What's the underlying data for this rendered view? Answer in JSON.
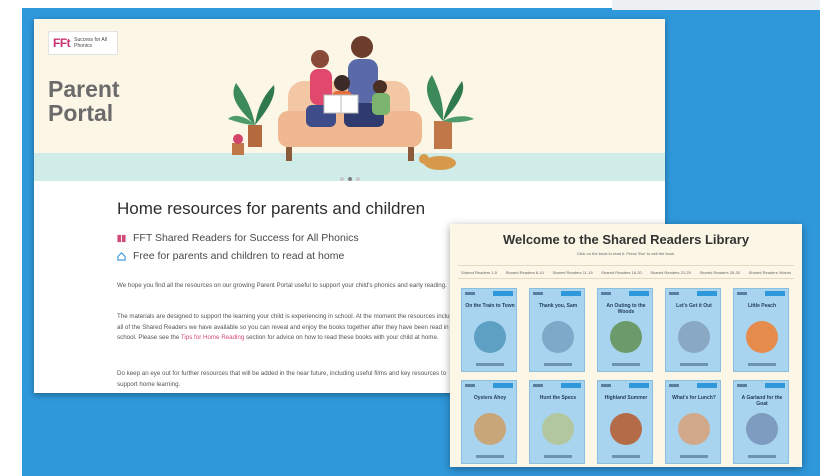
{
  "portal": {
    "logo_mark": "FFt",
    "logo_text": "Success for All Phonics",
    "title_line1": "Parent",
    "title_line2": "Portal",
    "heading": "Home resources for parents and children",
    "bullets": [
      "FFT Shared Readers for Success for All Phonics",
      "Free for parents and children to read at home"
    ],
    "paragraph1": "We hope you find all the resources on our growing Parent Portal useful to support your child's phonics and early reading.",
    "paragraph2_a": "The materials are designed to support the learning your child is experiencing in school. At the moment the resources include all of the Shared Readers we have available so you can reveal and enjoy the books together after they have been read in school. Please see the ",
    "paragraph2_link": "Tips for Home Reading",
    "paragraph2_b": " section for advice on how to read these books with your child at home.",
    "paragraph3": "Do keep an eye out for further resources that will be added in the near future, including useful films and key resources to support home learning."
  },
  "library": {
    "title": "Welcome to the Shared Readers Library",
    "subtitle": "Click on the book to read it. Press 'Esc' to exit the book.",
    "tabs": [
      "Shared Readers 1-5",
      "Shared Readers 6-10",
      "Shared Readers 11-15",
      "Shared Readers 16-20",
      "Shared Readers 21-25",
      "Shared Readers 26-30",
      "Shared Readers Videos"
    ],
    "books": [
      {
        "title": "On the Train to Town",
        "art": "#5e9fc4"
      },
      {
        "title": "Thank you, Sam",
        "art": "#7fa9c8"
      },
      {
        "title": "An Outing to the Woods",
        "art": "#6d9a6a"
      },
      {
        "title": "Let's Get it Out",
        "art": "#89a8c4"
      },
      {
        "title": "Little Peach",
        "art": "#e58b4c"
      },
      {
        "title": "Oysters Ahoy",
        "art": "#c9a57a"
      },
      {
        "title": "Hunt the Specs",
        "art": "#b2c7a0"
      },
      {
        "title": "Highland Summer",
        "art": "#b46b47"
      },
      {
        "title": "What's for Lunch?",
        "art": "#d1a88a"
      },
      {
        "title": "A Garland for the Goat",
        "art": "#7e9cbf"
      }
    ]
  },
  "colors": {
    "background_blue": "#2f98db",
    "hero_cream": "#fbf6e6",
    "hero_mint": "#cfece8",
    "accent_pink": "#d14a7a",
    "book_blue": "#a9d4ef"
  }
}
